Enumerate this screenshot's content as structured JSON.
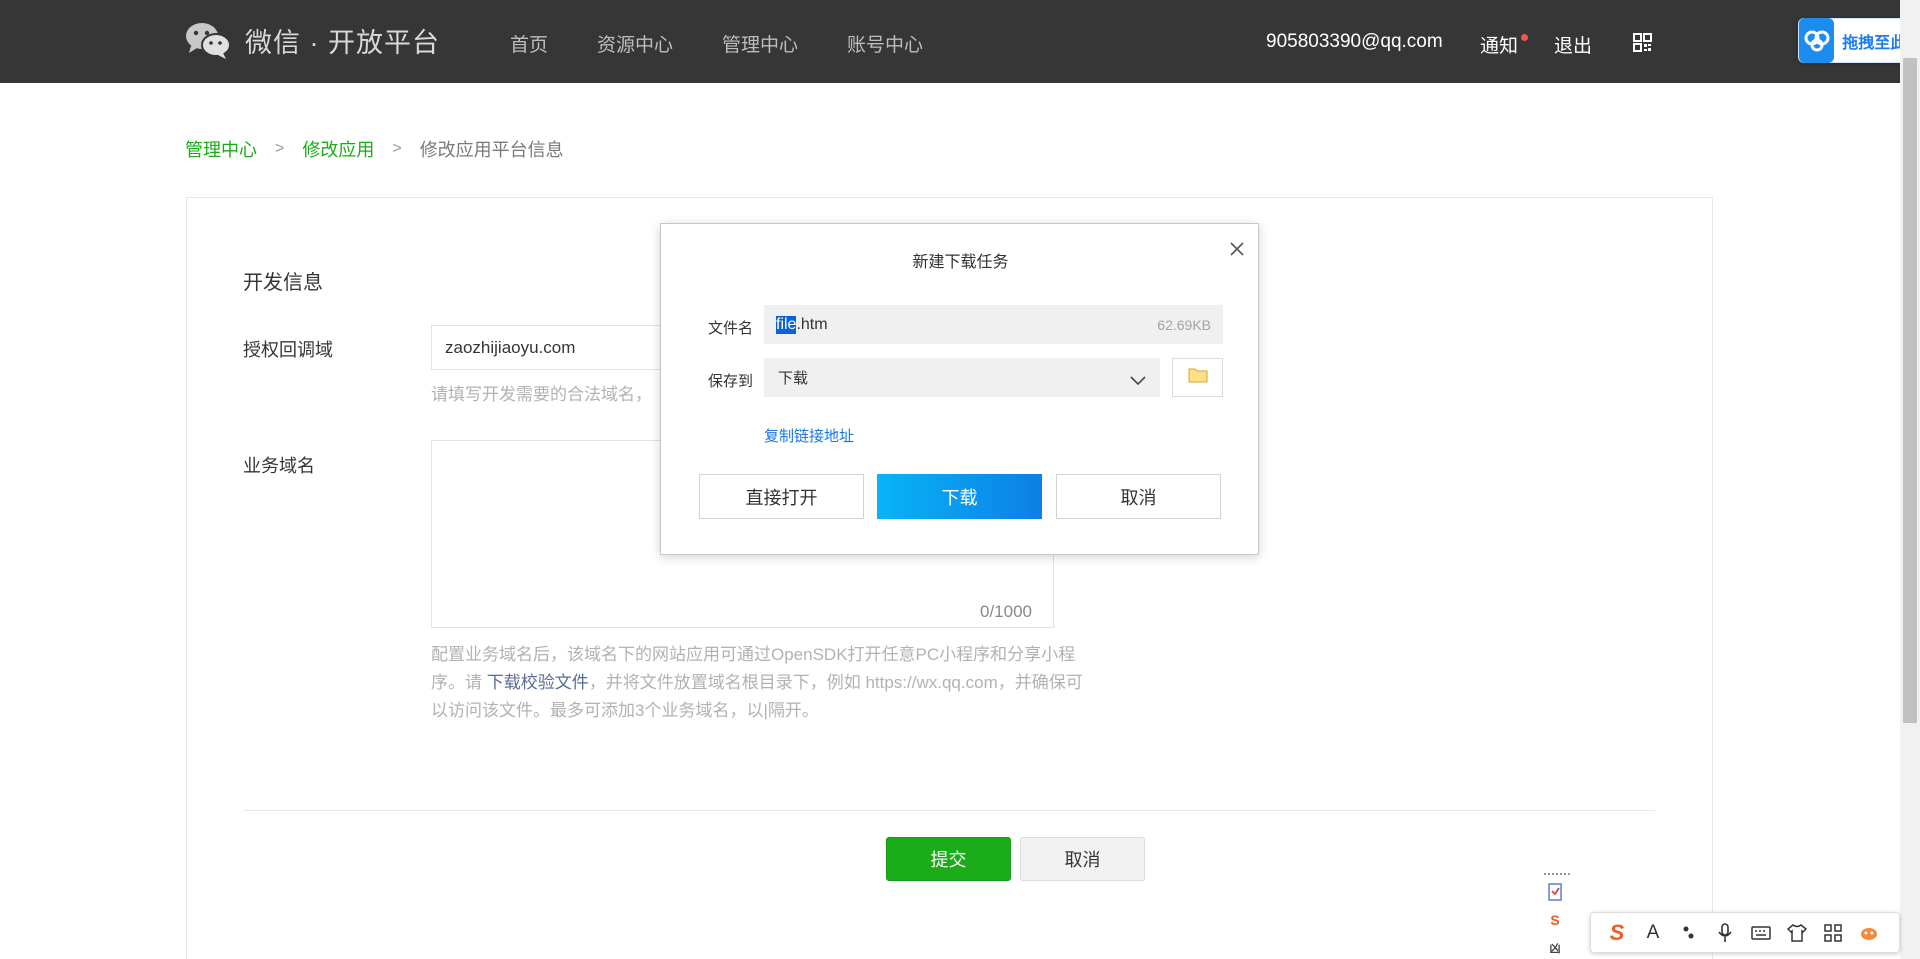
{
  "header": {
    "logo_text": "微信 · 开放平台",
    "nav": [
      "首页",
      "资源中心",
      "管理中心",
      "账号中心"
    ],
    "user_email": "905803390@qq.com",
    "notify": "通知",
    "logout": "退出",
    "baidu_float_label": "拖拽至此上传"
  },
  "breadcrumb": {
    "items": [
      "管理中心",
      "修改应用"
    ],
    "current": "修改应用平台信息",
    "separator": ">"
  },
  "form": {
    "section_title": "开发信息",
    "auth_label": "授权回调域",
    "auth_value": "zaozhijiaoyu.com",
    "auth_hint": "请填写开发需要的合法域名，",
    "biz_label": "业务域名",
    "biz_counter": "0/1000",
    "biz_desc_1": "配置业务域名后，该域名下的网站应用可通过OpenSDK打开任意PC小程序和分享小程序。请 ",
    "biz_desc_link": "下载校验文件",
    "biz_desc_2": "，并将文件放置域名根目录下，例如 https://wx.qq.com，并确保可以访问该文件。最多可添加3个业务域名，以|隔开。",
    "submit": "提交",
    "cancel": "取消"
  },
  "dialog": {
    "title": "新建下载任务",
    "filename_label": "文件名",
    "filename_selected": "file",
    "filename_rest": ".htm",
    "filesize": "62.69KB",
    "save_label": "保存到",
    "save_value": "下载",
    "copy_link": "复制链接地址",
    "btn_open": "直接打开",
    "btn_download": "下载",
    "btn_cancel": "取消"
  },
  "ime": {
    "side_items": [
      "S",
      "凶"
    ],
    "bar_items": [
      "S",
      "A",
      "•,",
      "mic",
      "keyboard",
      "shirt",
      "grid",
      "pet"
    ]
  },
  "colors": {
    "topbar": "#363636",
    "brand_green": "#1aad19",
    "link_blue": "#576b95",
    "dialog_blue": "#0c7fe6"
  }
}
